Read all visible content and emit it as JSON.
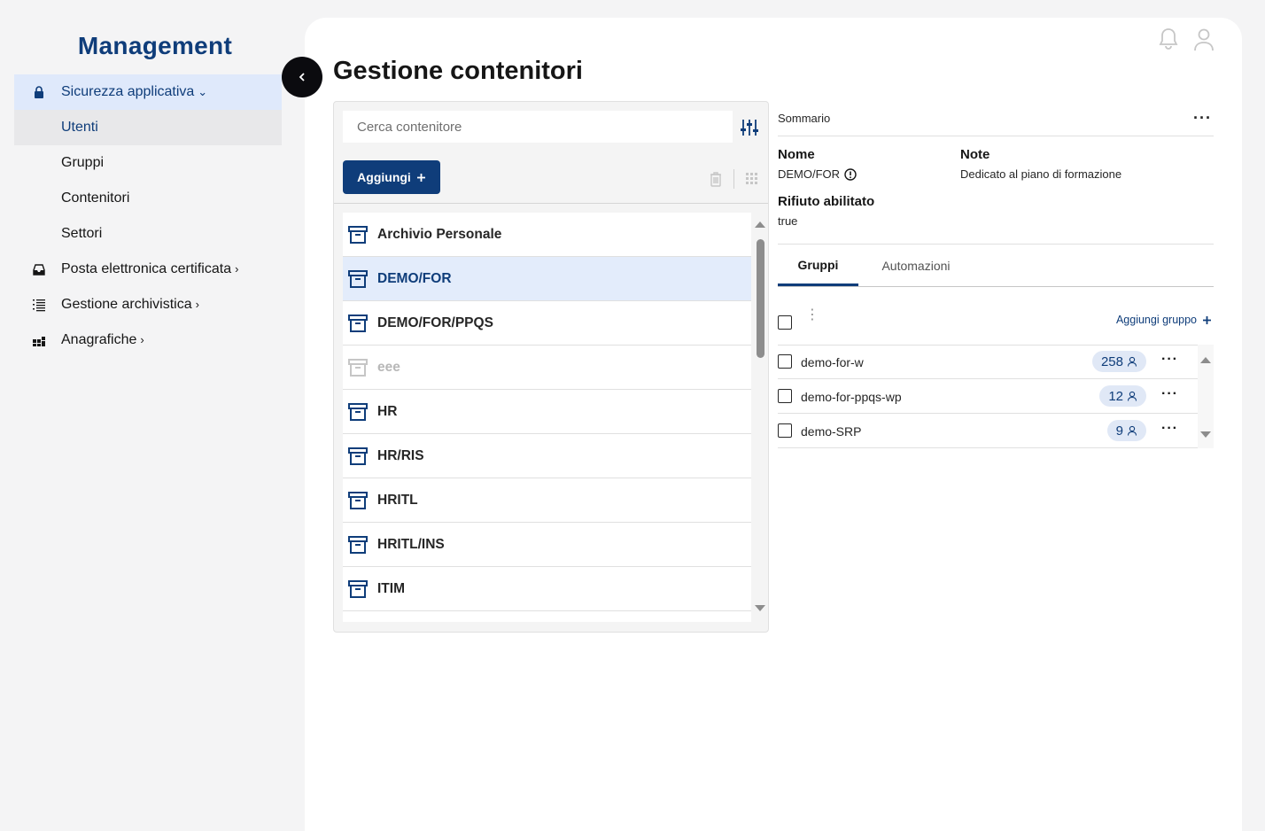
{
  "brand": "Management",
  "sidebar": {
    "items": [
      {
        "label": "Sicurezza applicativa",
        "icon": "lock-icon",
        "chevron": "⌄"
      },
      {
        "label": "Utenti"
      },
      {
        "label": "Gruppi"
      },
      {
        "label": "Contenitori"
      },
      {
        "label": "Settori"
      },
      {
        "label": "Posta elettronica certificata",
        "icon": "inbox-icon",
        "chevron": "›"
      },
      {
        "label": "Gestione archivistica",
        "icon": "list-icon",
        "chevron": "›"
      },
      {
        "label": "Anagrafiche",
        "icon": "grid-icon",
        "chevron": "›"
      }
    ]
  },
  "header": {
    "title": "Gestione contenitori"
  },
  "list_panel": {
    "search_placeholder": "Cerca contenitore",
    "add_label": "Aggiungi",
    "items": [
      "Archivio Personale",
      "DEMO/FOR",
      "DEMO/FOR/PPQS",
      "eee",
      "HR",
      "HR/RIS",
      "HRITL",
      "HRITL/INS",
      "ITIM"
    ],
    "selected": "DEMO/FOR",
    "disabled": "eee"
  },
  "details": {
    "summary_label": "Sommario",
    "name_label": "Nome",
    "name_value": "DEMO/FOR",
    "note_label": "Note",
    "note_value": "Dedicato al piano di formazione",
    "reject_label": "Rifiuto abilitato",
    "reject_value": "true",
    "tabs": [
      "Gruppi",
      "Automazioni"
    ],
    "add_group_label": "Aggiungi gruppo",
    "groups": [
      {
        "name": "demo-for-w",
        "count": "258"
      },
      {
        "name": "demo-for-ppqs-wp",
        "count": "12"
      },
      {
        "name": "demo-SRP",
        "count": "9"
      }
    ]
  },
  "colors": {
    "accent": "#0f3d7a",
    "selected_bg": "#e3ecfb",
    "sidebar_active": "#dfe9fb"
  }
}
